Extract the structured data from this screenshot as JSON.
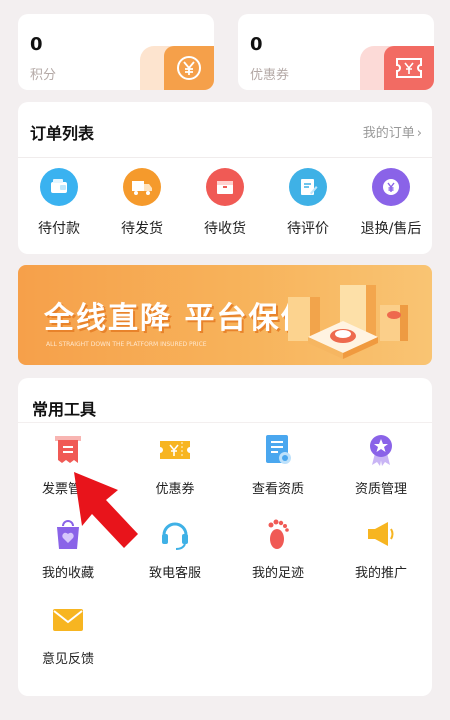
{
  "points": [
    {
      "value": "0",
      "label": "积分",
      "icon": "yen-coin-icon",
      "color": "#f5a04a",
      "bg": "#fde4cf"
    },
    {
      "value": "0",
      "label": "优惠券",
      "icon": "ticket-icon",
      "color": "#f26b63",
      "bg": "#fcdad7"
    }
  ],
  "orders": {
    "title": "订单列表",
    "more": "我的订单",
    "items": [
      {
        "label": "待付款",
        "icon": "wallet-icon",
        "color": "#3ab2f0"
      },
      {
        "label": "待发货",
        "icon": "truck-icon",
        "color": "#f59a2c"
      },
      {
        "label": "待收货",
        "icon": "box-icon",
        "color": "#f05a55"
      },
      {
        "label": "待评价",
        "icon": "edit-note-icon",
        "color": "#3fb1e6"
      },
      {
        "label": "退换/售后",
        "icon": "yen-return-icon",
        "color": "#8a63e8"
      }
    ]
  },
  "banner": {
    "headline": "全线直降 平台保价",
    "subline": "ALL STRAIGHT DOWN THE PLATFORM INSURED PRICE"
  },
  "tools": {
    "title": "常用工具",
    "items": [
      {
        "label": "发票管理",
        "icon": "invoice-icon",
        "color": "#f05a55"
      },
      {
        "label": "优惠券",
        "icon": "coupon-icon",
        "color": "#f7b521"
      },
      {
        "label": "查看资质",
        "icon": "certificate-icon",
        "color": "#4aa7ef"
      },
      {
        "label": "资质管理",
        "icon": "award-icon",
        "color": "#8a63e8"
      },
      {
        "label": "我的收藏",
        "icon": "favorite-bag-icon",
        "color": "#8a63e8"
      },
      {
        "label": "致电客服",
        "icon": "headset-icon",
        "color": "#3fb1e6"
      },
      {
        "label": "我的足迹",
        "icon": "footprint-icon",
        "color": "#f05a55"
      },
      {
        "label": "我的推广",
        "icon": "megaphone-icon",
        "color": "#f7b521"
      },
      {
        "label": "意见反馈",
        "icon": "mail-icon",
        "color": "#f7b521"
      }
    ]
  },
  "annotation": {
    "color": "#e8141b"
  }
}
